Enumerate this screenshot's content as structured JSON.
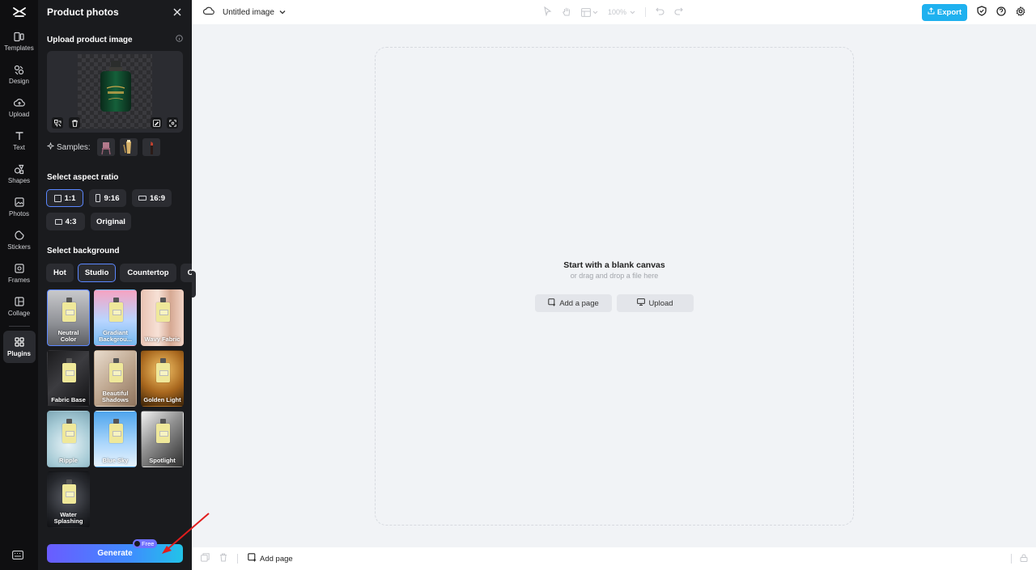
{
  "rail": {
    "items": [
      {
        "label": "Templates",
        "icon": "templates-icon"
      },
      {
        "label": "Design",
        "icon": "design-icon"
      },
      {
        "label": "Upload",
        "icon": "upload-cloud-icon"
      },
      {
        "label": "Text",
        "icon": "text-icon"
      },
      {
        "label": "Shapes",
        "icon": "shapes-icon"
      },
      {
        "label": "Photos",
        "icon": "photos-icon"
      },
      {
        "label": "Stickers",
        "icon": "stickers-icon"
      },
      {
        "label": "Frames",
        "icon": "frames-icon"
      },
      {
        "label": "Collage",
        "icon": "collage-icon"
      },
      {
        "label": "Plugins",
        "icon": "plugins-icon"
      }
    ]
  },
  "panel": {
    "title": "Product photos",
    "upload_title": "Upload product image",
    "samples_label": "Samples:",
    "aspect_title": "Select aspect ratio",
    "aspect_ratios": [
      "1:1",
      "9:16",
      "16:9",
      "4:3",
      "Original"
    ],
    "aspect_selected": "1:1",
    "background_title": "Select background",
    "background_tabs": [
      "Hot",
      "Studio",
      "Countertop",
      "O"
    ],
    "background_tab_selected": "Studio",
    "backgrounds": [
      {
        "name": "Neutral Color"
      },
      {
        "name": "Gradiant Backgrou..."
      },
      {
        "name": "Wavy Fabric"
      },
      {
        "name": "Fabric Base"
      },
      {
        "name": "Beautiful Shadows"
      },
      {
        "name": "Golden Light"
      },
      {
        "name": "Ripple"
      },
      {
        "name": "Blue Sky"
      },
      {
        "name": "Spotlight"
      },
      {
        "name": "Water Splashing"
      }
    ],
    "generate_label": "Generate",
    "free_badge": "Free"
  },
  "topbar": {
    "doc_title": "Untitled image",
    "zoom": "100%",
    "export_label": "Export"
  },
  "canvas": {
    "title": "Start with a blank canvas",
    "subtitle": "or drag and drop a file here",
    "add_page_label": "Add a page",
    "upload_label": "Upload"
  },
  "bottombar": {
    "add_page_label": "Add page"
  },
  "colors": {
    "accent": "#5b87ff",
    "export": "#1fb1ef",
    "panel_bg": "#1a1b1e",
    "rail_bg": "#0f0f11",
    "annotation_arrow": "#e11d1d"
  }
}
